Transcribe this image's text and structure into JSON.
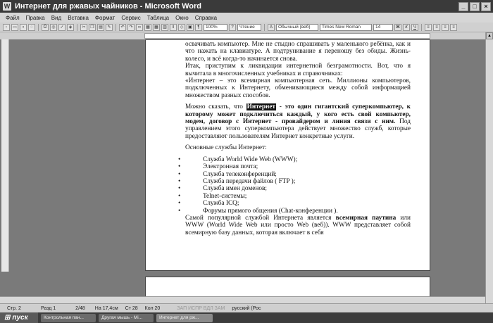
{
  "window": {
    "title": "Интернет для ржавых чайников - Microsoft Word"
  },
  "menu": [
    "Файл",
    "Правка",
    "Вид",
    "Вставка",
    "Формат",
    "Сервис",
    "Таблица",
    "Окно",
    "Справка"
  ],
  "toolbar": {
    "zoom": "100%",
    "read_label": "Чтение",
    "style": "Обычный (веб)",
    "font": "Times New Roman",
    "size": "14"
  },
  "doc": {
    "lines_top": "освачивать компьютер. Мне не стыдно спрашивать у маленького ребёнка, как и что нажать на клавиатуре. А подтрунивание я переношу без обиды. Жизнь- колесо, и всё когда-то начинается снова.",
    "p2": "Итак, приступим к ликвидации интернетной безграмотности. Вот, что я вычитала в многочисленных учебниках и справочниках:",
    "p3": "«Интернет – это всемирная компьютерная сеть. Миллионы компьютеров, подключенных к Интернету, обменивающиеся между собой информацией множеством разных способов.",
    "p4_a": "Можно сказать, что ",
    "p4_hl": "Интернет",
    "p4_b": " - это один гигантский суперкомпьютер, к которому может подключиться каждый, у кого есть свой компьютер, модем, договор с Интернет - провайдером и линия связи с ним.",
    "p4_c": " Под управлением этого суперкомпьютера действует множество служб, которые предоставляют пользователям Интернет конкретные услуги.",
    "services_heading": "Основные службы Интернет:",
    "services": [
      "Служба World Wide Web (WWW);",
      "Электронная почта;",
      "Служба телеконференций;",
      "Служба передачи файлов ( FTP );",
      "Служба имен доменов;",
      "Telnet-системы;",
      "Служба ICQ;",
      "Форумы прямого общения (Chat-конференции )."
    ],
    "p5_a": "Самой популярной службой Интернета является ",
    "p5_b": "всемирная паутина",
    "p5_c": " или WWW (World Wide Web или просто Web (веб)). WWW представляет собой всемирную базу данных, которая включает в себя"
  },
  "status": {
    "page": "Стр. 2",
    "section": "Разд 1",
    "pages": "2/48",
    "at": "На 17,4см",
    "line": "Ст 28",
    "col": "Кол 20",
    "modes": "ЗАП  ИСПР  ВДЛ  ЗАМ",
    "lang": "русский (Рос"
  },
  "taskbar": {
    "start": "пуск",
    "tasks": [
      "Контрольная пан...",
      "Другая мышь - Mi...",
      "Интернет для рж..."
    ]
  }
}
